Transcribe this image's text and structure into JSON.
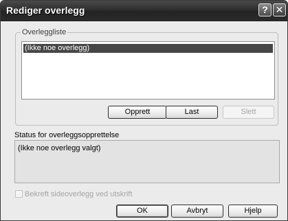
{
  "window": {
    "title": "Rediger overlegg",
    "help_glyph": "?",
    "close_glyph": "✕"
  },
  "overlay_group": {
    "legend": "Overleggliste",
    "items": [
      "(Ikke noe overlegg)"
    ],
    "selected_index": 0,
    "buttons": {
      "create": "Opprett",
      "load": "Last",
      "delete": "Slett"
    }
  },
  "status": {
    "label": "Status for overleggsopprettelse",
    "text": "(Ikke noe overlegg valgt)"
  },
  "confirm_checkbox": {
    "label": "Bekreft sideoverlegg ved utskrift",
    "checked": false,
    "enabled": false
  },
  "footer_buttons": {
    "ok": "OK",
    "cancel": "Avbryt",
    "help": "Hjelp"
  },
  "colors": {
    "titlebar": "#2b2b2b",
    "selection": "#464646",
    "dialog_bg": "#ebebeb"
  }
}
